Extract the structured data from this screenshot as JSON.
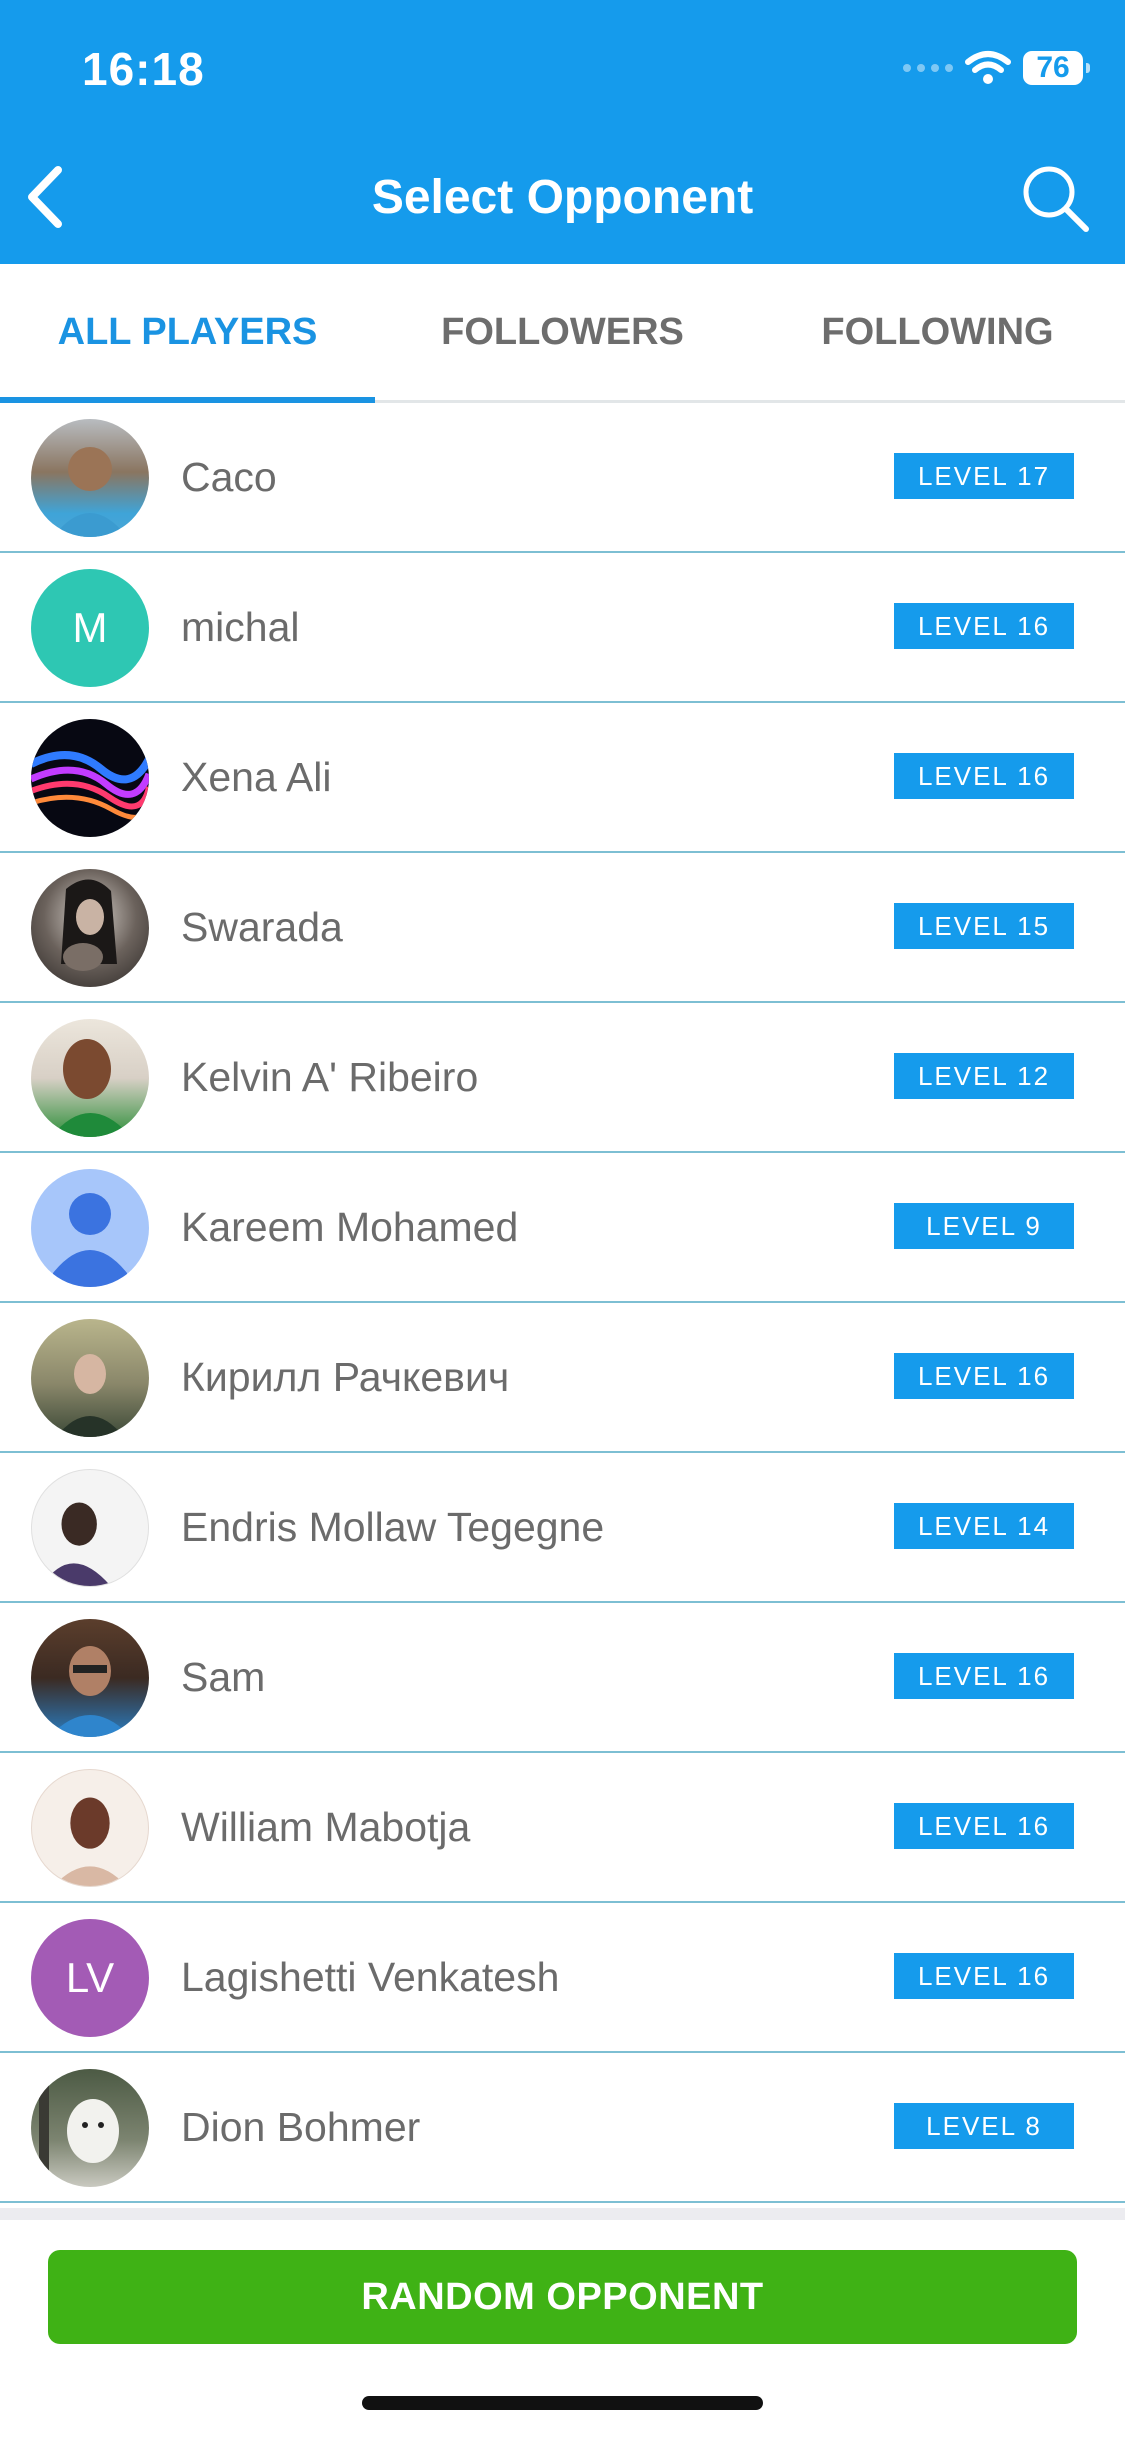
{
  "status_bar": {
    "time": "16:18",
    "battery": "76"
  },
  "header": {
    "title": "Select Opponent",
    "back_icon": "chevron-left-icon",
    "search_icon": "search-icon"
  },
  "tabs": [
    {
      "label": "ALL PLAYERS",
      "active": true
    },
    {
      "label": "FOLLOWERS",
      "active": false
    },
    {
      "label": "FOLLOWING",
      "active": false
    }
  ],
  "players": [
    {
      "name": "Caco",
      "level": "LEVEL 17",
      "avatar": "photo"
    },
    {
      "name": "michal",
      "level": "LEVEL 16",
      "avatar_initials": "M",
      "avatar_color": "#2ec7b3"
    },
    {
      "name": "Xena Ali",
      "level": "LEVEL 16",
      "avatar": "photo"
    },
    {
      "name": "Swarada",
      "level": "LEVEL 15",
      "avatar": "photo"
    },
    {
      "name": "Kelvin A' Ribeiro",
      "level": "LEVEL 12",
      "avatar": "photo"
    },
    {
      "name": "Kareem Mohamed",
      "level": "LEVEL 9",
      "avatar": "default-person-icon"
    },
    {
      "name": "Кирилл Рачкевич",
      "level": "LEVEL 16",
      "avatar": "photo"
    },
    {
      "name": "Endris Mollaw Tegegne",
      "level": "LEVEL 14",
      "avatar": "photo"
    },
    {
      "name": "Sam",
      "level": "LEVEL 16",
      "avatar": "photo"
    },
    {
      "name": "William Mabotja",
      "level": "LEVEL 16",
      "avatar": "photo"
    },
    {
      "name": "Lagishetti Venkatesh",
      "level": "LEVEL 16",
      "avatar_initials": "LV",
      "avatar_color": "#a35bb5"
    },
    {
      "name": "Dion Bohmer",
      "level": "LEVEL 8",
      "avatar": "photo"
    }
  ],
  "footer": {
    "random_label": "RANDOM OPPONENT"
  },
  "colors": {
    "primary": "#159bec",
    "button_green": "#3fb215",
    "divider": "#7dbfd3"
  }
}
